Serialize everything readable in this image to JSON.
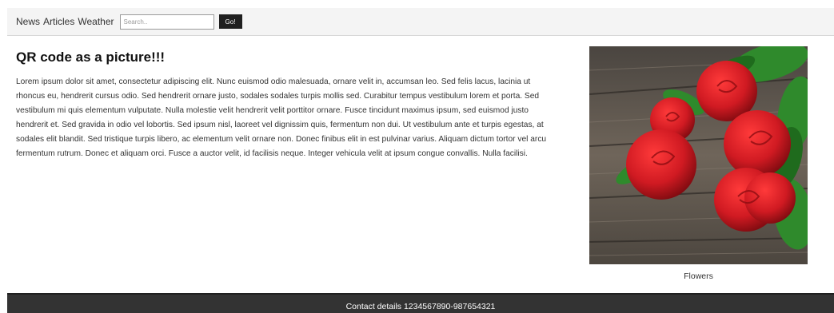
{
  "nav": {
    "links": [
      "News",
      "Articles",
      "Weather"
    ],
    "search_placeholder": "Search..",
    "search_value": "",
    "go_label": "Go!"
  },
  "main": {
    "title": "QR code as a picture!!!",
    "body": "Lorem ipsum dolor sit amet, consectetur adipiscing elit. Nunc euismod odio malesuada, ornare velit in, accumsan leo. Sed felis lacus, lacinia ut rhoncus eu, hendrerit cursus odio. Sed hendrerit ornare justo, sodales sodales turpis mollis sed. Curabitur tempus vestibulum lorem et porta. Sed vestibulum mi quis elementum vulputate. Nulla molestie velit hendrerit velit porttitor ornare. Fusce tincidunt maximus ipsum, sed euismod justo hendrerit et. Sed gravida in odio vel lobortis. Sed ipsum nisl, laoreet vel dignissim quis, fermentum non dui. Ut vestibulum ante et turpis egestas, at sodales elit blandit. Sed tristique turpis libero, ac elementum velit ornare non. Donec finibus elit in est pulvinar varius. Aliquam dictum tortor vel arcu fermentum rutrum. Donec et aliquam orci. Fusce a auctor velit, id facilisis neque. Integer vehicula velit at ipsum congue convallis. Nulla facilisi."
  },
  "figure": {
    "caption": "Flowers",
    "colors": {
      "wood_dark": "#3e3a36",
      "wood_light": "#7a6f63",
      "rose": "#d01a22",
      "rose_dark": "#8e0d12",
      "leaf": "#2f8a2c"
    }
  },
  "footer": {
    "text": "Contact details 1234567890-987654321"
  }
}
